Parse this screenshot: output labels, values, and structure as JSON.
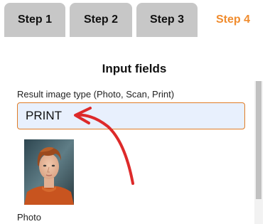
{
  "tabs": [
    {
      "label": "Step 1",
      "active": false
    },
    {
      "label": "Step 2",
      "active": false
    },
    {
      "label": "Step 3",
      "active": false
    },
    {
      "label": "Step 4",
      "active": true
    }
  ],
  "section": {
    "title": "Input fields"
  },
  "result_type_field": {
    "label": "Result image type (Photo, Scan, Print)",
    "value": "PRINT"
  },
  "photo": {
    "label": "Photo"
  },
  "colors": {
    "active_tab": "#f08c2e",
    "inactive_tab": "#c7c7c7",
    "input_bg": "#e8f0fd",
    "input_border": "#e07c26",
    "annotation_arrow": "#dd2a2a"
  },
  "icons": [
    "red-curved-arrow-annotation"
  ]
}
